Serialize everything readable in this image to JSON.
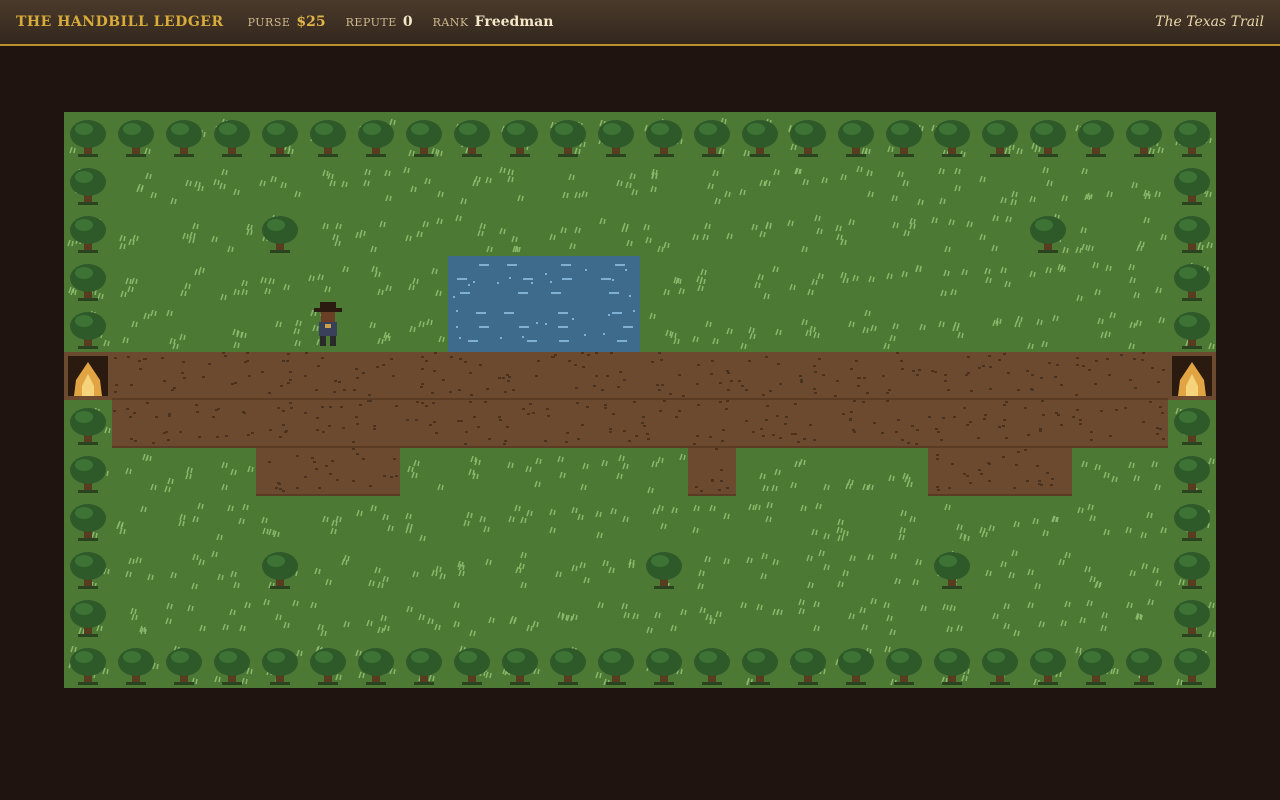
{
  "hud": {
    "title": "THE HANDBILL LEDGER",
    "purse_label": "PURSE",
    "purse_value": "$25",
    "repute_label": "REPUTE",
    "repute_value": "0",
    "rank_label": "RANK",
    "rank_value": "Freedman",
    "region": "The Texas Trail"
  },
  "colors": {
    "grass": "#4c7a34",
    "grass_tuft": "#8ab76a",
    "dirt": "#6b4a2f",
    "dirt_speck": "#4a3220",
    "water": "#3e6a8c",
    "water_ripple": "#7fb0d4",
    "tree_canopy": "#2e5a2a",
    "tree_trunk": "#5a3a20",
    "campfire": "#e2a442",
    "accent_gold": "#d8ac3a"
  },
  "map": {
    "cols": 24,
    "rows": 12,
    "rows_layout": [
      "TTTTTTTTTTTTTTTTTTTTTTTT",
      "T......................T",
      "T...T...............T..T",
      "T.......WWWW...........T",
      "T.......WWWW...........T",
      "FDDDDDDDDDDDDDDDDDDDDDDF",
      "TDDDDDDDDDDDDDDDDDDDDDDT",
      "T...DDD......D....DDD..T",
      "T......................T",
      "T...T.......T.....T....T",
      "T......................T",
      "TTTTTTTTTTTTTTTTTTTTTTTT"
    ],
    "legend": {
      "T": "tree",
      ".": "grass",
      "W": "water",
      "D": "dirt-road",
      "F": "campfire"
    },
    "player": {
      "col": 5,
      "row": 4,
      "facing": "south"
    }
  }
}
